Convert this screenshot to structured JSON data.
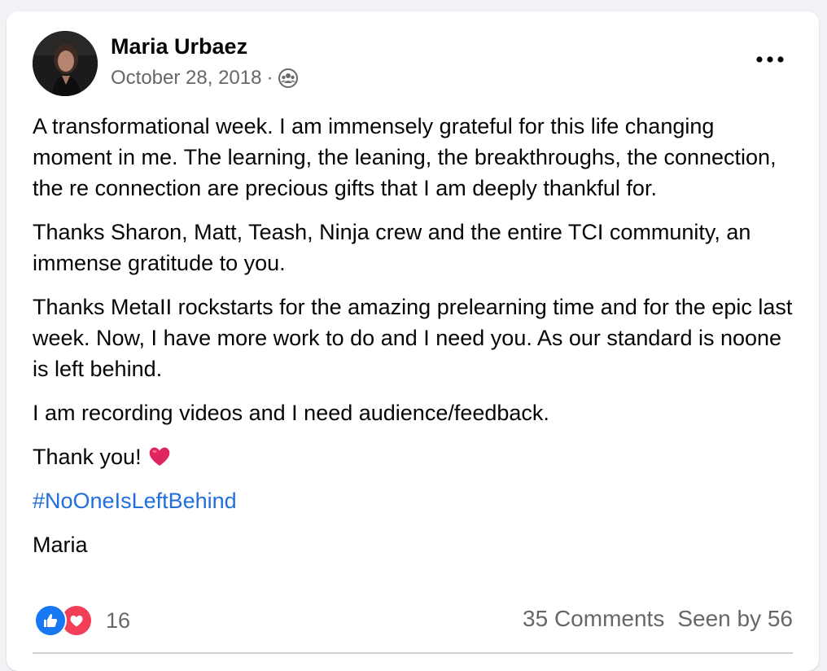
{
  "post": {
    "author": "Maria Urbaez",
    "date": "October 28, 2018",
    "separator": "·",
    "audience_icon": "group-icon",
    "more_icon": "more-horizontal-icon",
    "paragraphs": [
      "A transformational week. I am immensely grateful for this life changing moment in me. The learning, the leaning, the breakthroughs, the connection, the re connection are precious gifts that I am deeply thankful for.",
      "Thanks Sharon, Matt, Teash, Ninja crew and the entire TCI community, an immense gratitude to you.",
      "Thanks MetaII rockstarts for the amazing prelearning time and for the epic last week.  Now, I have more work to do and I need you. As our standard is noone is left behind.",
      "I am recording videos and I need audience/feedback."
    ],
    "thanks_line": "Thank you!",
    "thanks_emoji": "red-heart-emoji",
    "hashtag": "#NoOneIsLeftBehind",
    "signature": "Maria"
  },
  "footer": {
    "reaction_icons": [
      "like-icon",
      "love-icon"
    ],
    "reaction_count": "16",
    "comments": "35 Comments",
    "seen_by": "Seen by 56"
  },
  "colors": {
    "background": "#f0f2f5",
    "card": "#ffffff",
    "text": "#050505",
    "secondary": "#65676b",
    "hashtag": "#216fdb",
    "like": "#1877f2",
    "love": "#f33e58",
    "heart": "#e0245e"
  }
}
